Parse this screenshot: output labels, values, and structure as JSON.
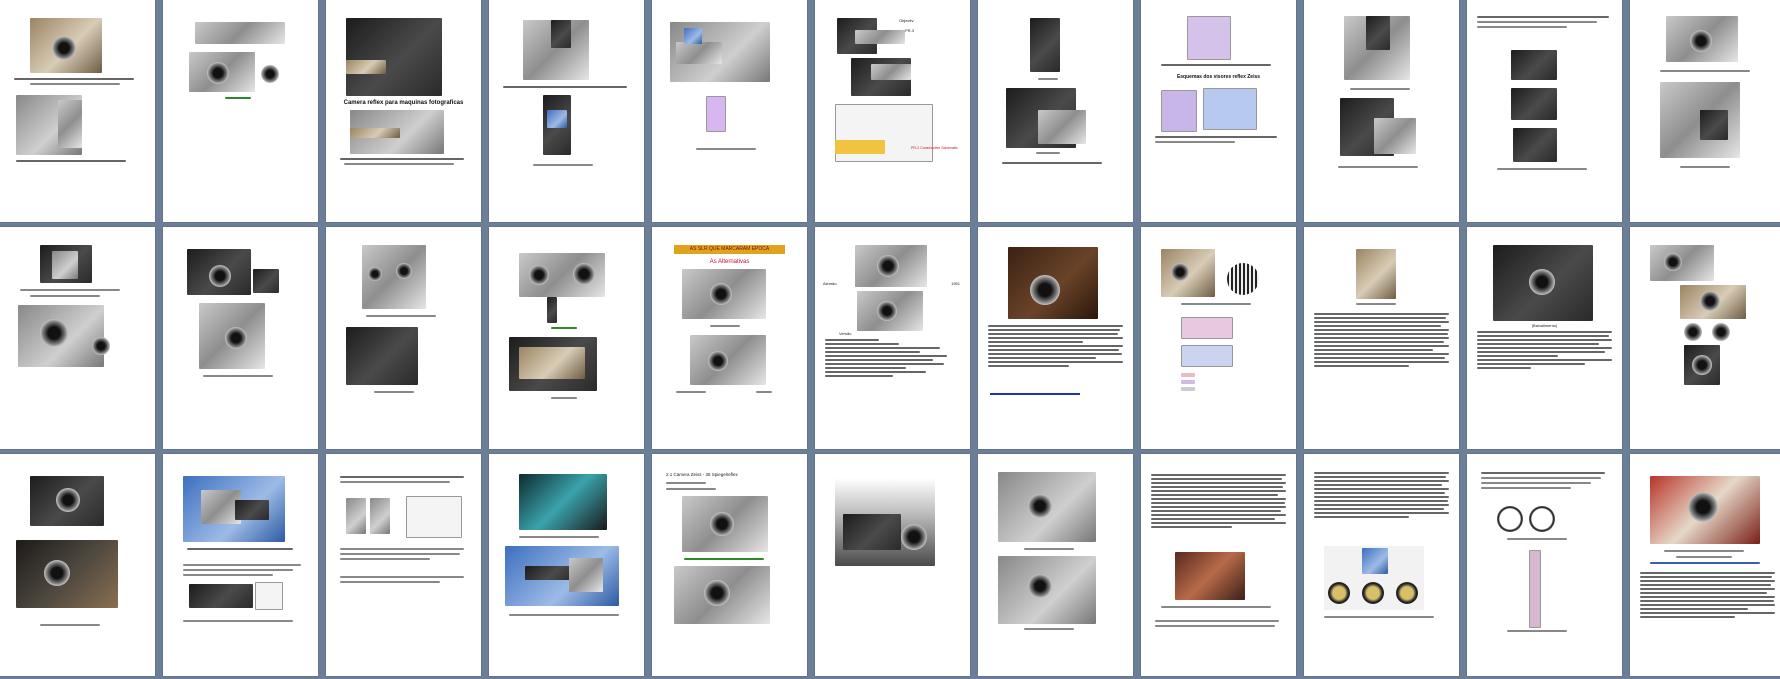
{
  "document": {
    "page_count": 33,
    "captions": {
      "p3_title": "Camera reflex para maquinas fotograficas",
      "p21_banner": "AS SLR QUE MARCARAM EPOCA",
      "p21_subtitle": "As Alternativas",
      "p22_label_left": "Alemão",
      "p22_label_right": "1951",
      "p22_section": "Versão",
      "p28_heading": "2.1 Camera Zeiss - 35 Spiegelreflex",
      "p6_label_a": "Objectiv",
      "p6_label_b": "PR-3",
      "p6_scheme": "PR-2 Constructive Schematic",
      "p8_heading": "Esquemas dos visores reflex Zeiss",
      "p18_caption": "(Baixalimento)"
    },
    "colors": {
      "background": "#6b7f98",
      "page": "#ffffff",
      "banner": "#e0a31e",
      "accent_red": "#c8102e",
      "link_blue": "#2030c0"
    }
  }
}
